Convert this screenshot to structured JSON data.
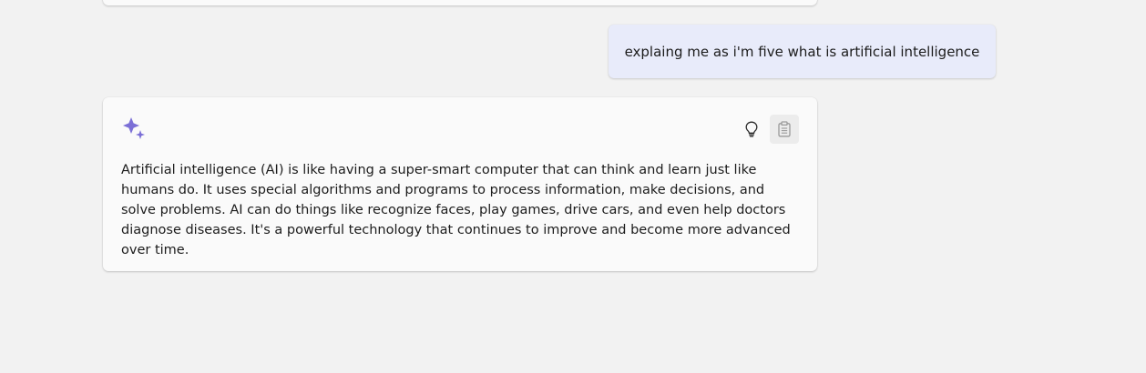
{
  "conversation": {
    "user_message": "explaing me as i'm five what is artificial intelligence",
    "ai_response": "Artificial intelligence (AI) is like having a super-smart computer that can think and learn just like humans do. It uses special algorithms and programs to process information, make decisions, and solve problems. AI can do things like recognize faces, play games, drive cars, and even help doctors diagnose diseases. It's a powerful technology that continues to improve and become more advanced over time."
  },
  "icons": {
    "assistant": "sparkle-icon",
    "suggest": "lightbulb-icon",
    "copy": "clipboard-icon"
  },
  "colors": {
    "background": "#f2f2f2",
    "card": "#fafafa",
    "user_bubble": "#e8ebfa",
    "sparkle": "#7b6fd6",
    "text": "#1c1c1c"
  }
}
